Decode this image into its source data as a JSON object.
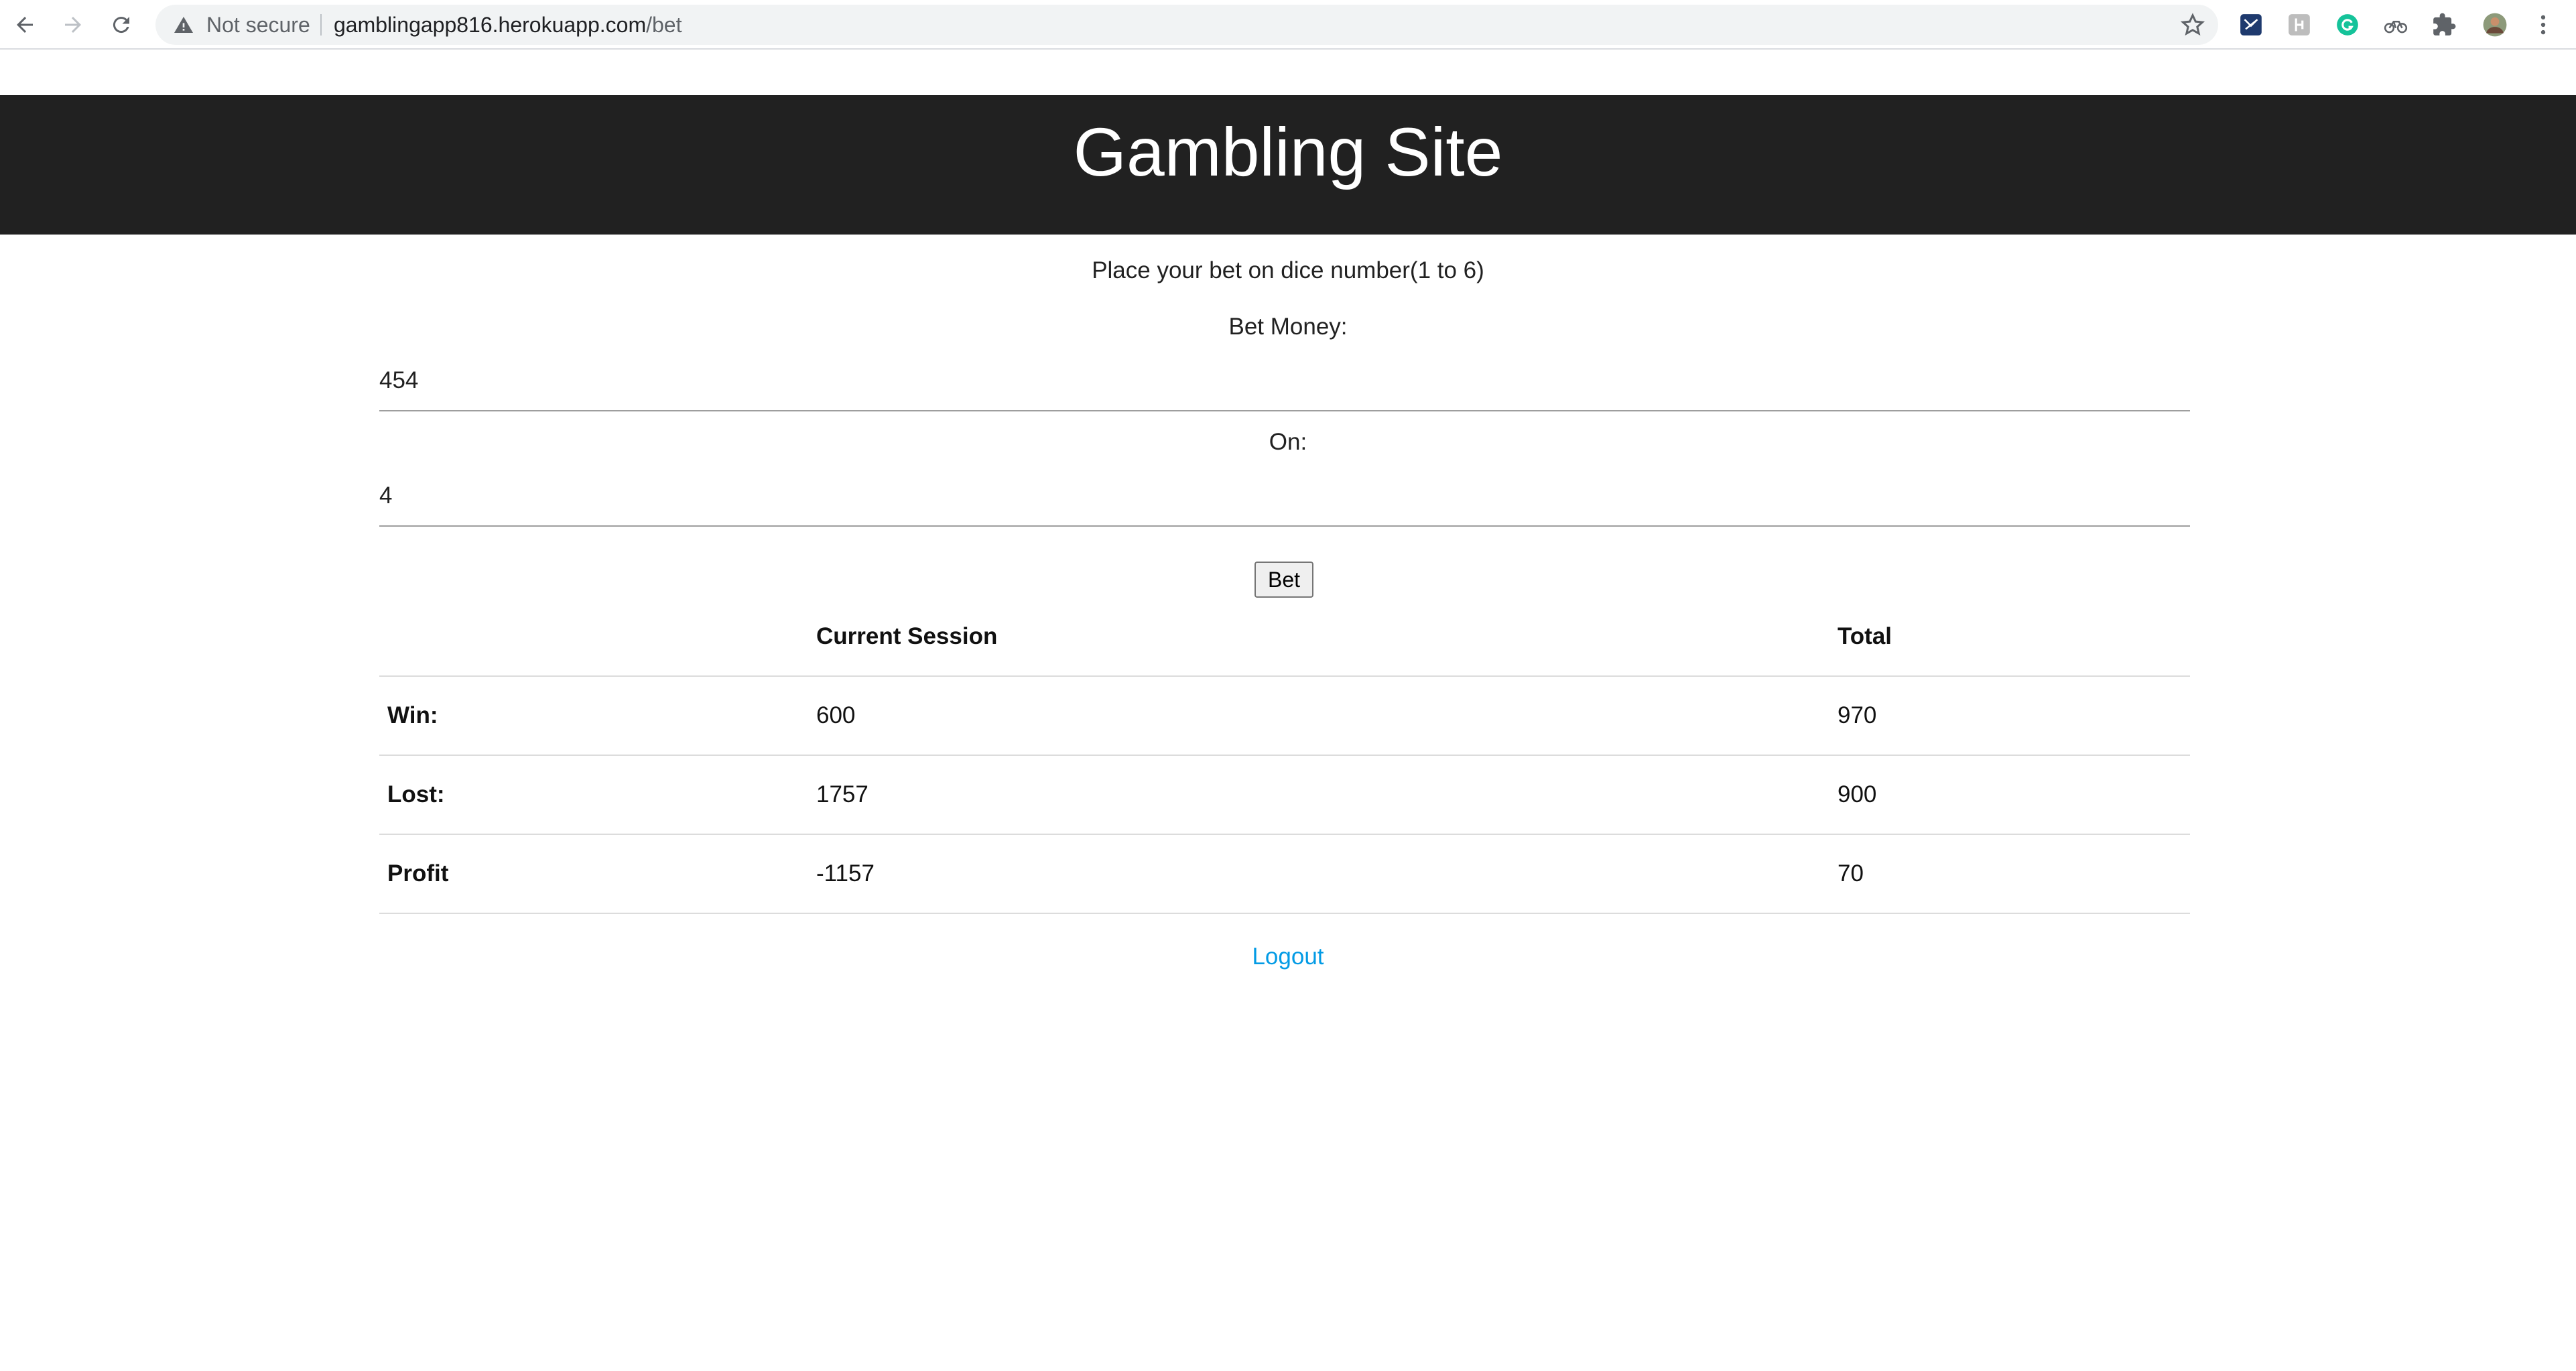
{
  "browser": {
    "security_label": "Not secure",
    "url_host": "gamblingapp816.herokuapp.com",
    "url_path": "/bet",
    "icons": [
      "back-icon",
      "forward-icon",
      "reload-icon",
      "warning-icon",
      "bookmark-star-icon",
      "extensions-icon",
      "menu-icon"
    ]
  },
  "header": {
    "title": "Gambling Site"
  },
  "form": {
    "instruction": "Place your bet on dice number(1 to 6)",
    "bet_money_label": "Bet Money:",
    "bet_money_value": "454",
    "on_label": "On:",
    "on_value": "4",
    "bet_button_label": "Bet"
  },
  "stats": {
    "headers": [
      "",
      "Current Session",
      "Total"
    ],
    "rows": [
      {
        "label": "Win:",
        "current": "600",
        "total": "970"
      },
      {
        "label": "Lost:",
        "current": "1757",
        "total": "900"
      },
      {
        "label": "Profit",
        "current": "-1157",
        "total": "70"
      }
    ]
  },
  "footer": {
    "logout_label": "Logout"
  },
  "colors": {
    "header_bg": "#212121",
    "link": "#039be5"
  }
}
